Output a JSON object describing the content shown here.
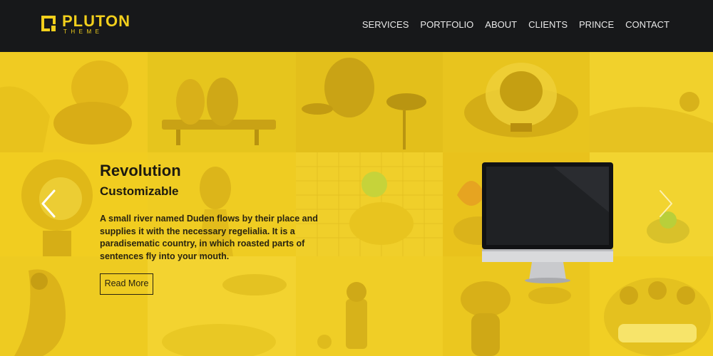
{
  "brand": {
    "name": "PLUTON",
    "tagline": "THEME",
    "accent_color": "#f2cf1c",
    "header_color": "#17181a"
  },
  "nav": {
    "items": [
      {
        "label": "SERVICES"
      },
      {
        "label": "PORTFOLIO"
      },
      {
        "label": "ABOUT"
      },
      {
        "label": "CLIENTS"
      },
      {
        "label": "PRINCE"
      },
      {
        "label": "CONTACT"
      }
    ]
  },
  "slide": {
    "title": "Revolution",
    "subtitle": "Customizable",
    "text": "A small river named Duden flows by their place and supplies it with the necessary regelialia. It is a paradisematic country, in which roasted parts of sentences fly into your mouth.",
    "button_label": "Read More"
  },
  "icons": {
    "prev": "chevron-left-icon",
    "next": "chevron-right-icon",
    "logo": "logo-bracket-icon",
    "device": "desktop-monitor"
  }
}
